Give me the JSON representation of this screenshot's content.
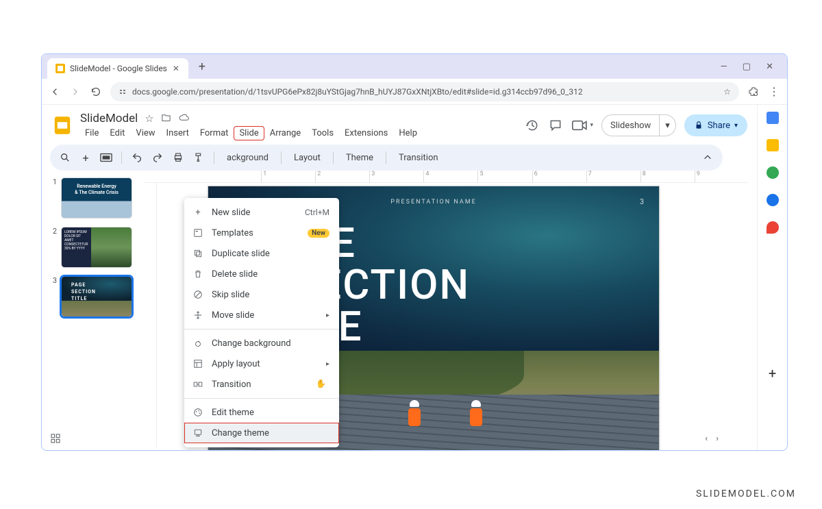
{
  "browser": {
    "tab_title": "SlideModel - Google Slides",
    "url": "docs.google.com/presentation/d/1tsvUPG6ePx82j8uYStGjag7hnB_hUYJ87GxXNtjXBto/edit#slide=id.g314ccb97d96_0_312"
  },
  "doc": {
    "title": "SlideModel",
    "menus": [
      "File",
      "Edit",
      "View",
      "Insert",
      "Format",
      "Slide",
      "Arrange",
      "Tools",
      "Extensions",
      "Help"
    ],
    "active_menu": "Slide",
    "slideshow_label": "Slideshow",
    "share_label": "Share"
  },
  "toolbar": {
    "background": "ackground",
    "layout": "Layout",
    "theme": "Theme",
    "transition": "Transition"
  },
  "ruler": [
    "1",
    "2",
    "3",
    "4",
    "5",
    "6",
    "7",
    "8",
    "9"
  ],
  "thumbs": {
    "t1_title": "Renewable Energy\n& The Climate Crisis",
    "t2_text": "LOREM IPSUM DOLOR SIT AMET CONSECTETUR 30% BY YYYY",
    "t3_title": "PAGE\nSECTION\nTITLE"
  },
  "slide": {
    "pres_name": "PRESENTATION NAME",
    "page_num": "3",
    "title_l1": "PAGE",
    "title_l2": "SECTION",
    "title_l3": "TITLE"
  },
  "context_menu": {
    "new_slide": "New slide",
    "new_slide_shortcut": "Ctrl+M",
    "templates": "Templates",
    "templates_badge": "New",
    "duplicate": "Duplicate slide",
    "delete": "Delete slide",
    "skip": "Skip slide",
    "move": "Move slide",
    "change_bg": "Change background",
    "apply_layout": "Apply layout",
    "transition": "Transition",
    "edit_theme": "Edit theme",
    "change_theme": "Change theme"
  },
  "footer": "SLIDEMODEL.COM"
}
